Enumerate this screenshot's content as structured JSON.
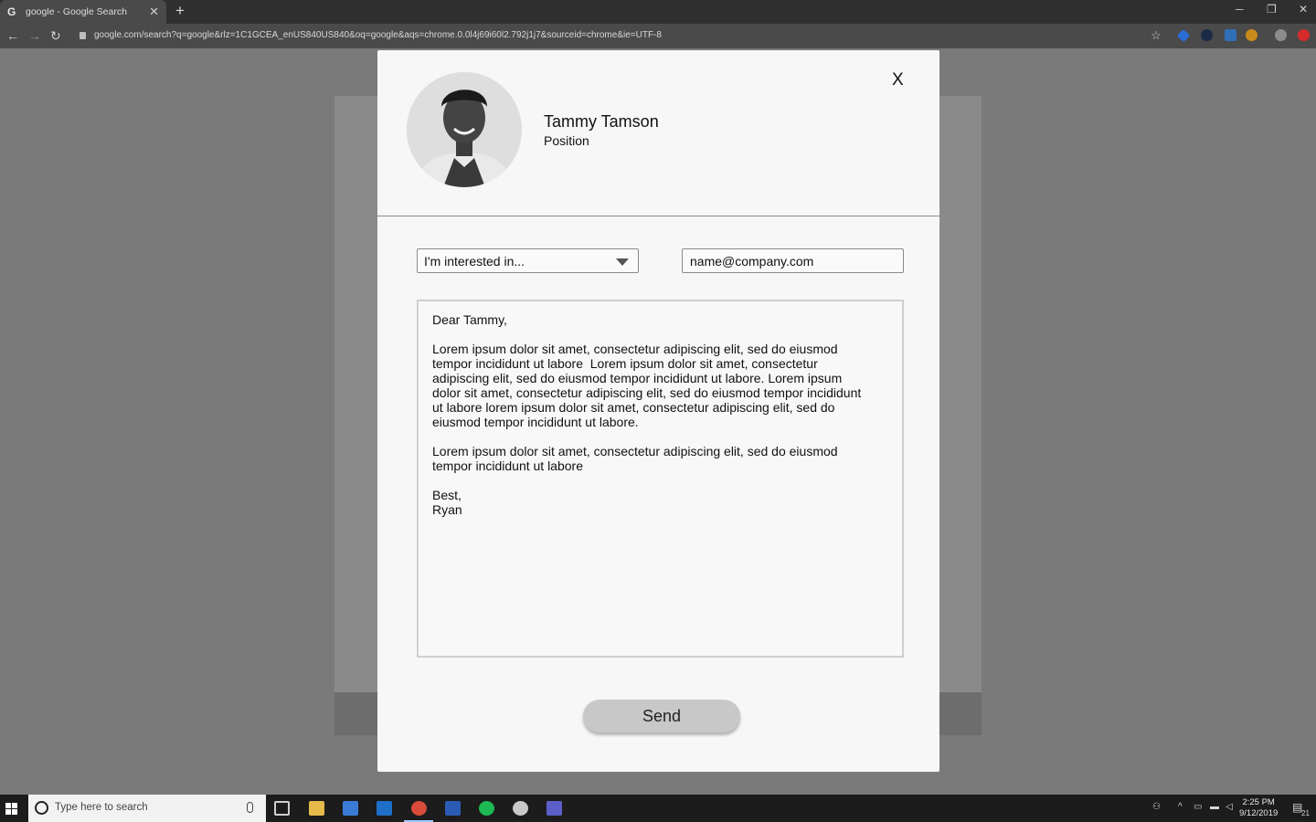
{
  "browser": {
    "tab_title": "google - Google Search",
    "tab_favicon": "G",
    "url": "google.com/search?q=google&rlz=1C1GCEA_enUS840US840&oq=google&aqs=chrome.0.0l4j69i60l2.792j1j7&sourceid=chrome&ie=UTF-8"
  },
  "modal": {
    "close_label": "X",
    "contact": {
      "name": "Tammy Tamson",
      "position": "Position"
    },
    "interest_select": {
      "selected": "I'm interested in..."
    },
    "email_field": {
      "value": "name@company.com"
    },
    "message": {
      "greeting": "Dear Tammy,",
      "paragraph1": "Lorem ipsum dolor sit amet, consectetur adipiscing elit, sed do eiusmod\ntempor incididunt ut labore  Lorem ipsum dolor sit amet, consectetur\nadipiscing elit, sed do eiusmod tempor incididunt ut labore. Lorem ipsum\ndolor sit amet, consectetur adipiscing elit, sed do eiusmod tempor incididunt\nut labore lorem ipsum dolor sit amet, consectetur adipiscing elit, sed do\neiusmod tempor incididunt ut labore.",
      "paragraph2": "Lorem ipsum dolor sit amet, consectetur adipiscing elit, sed do eiusmod\ntempor incididunt ut labore",
      "signoff": "Best,\nRyan"
    },
    "send_label": "Send"
  },
  "taskbar": {
    "search_placeholder": "Type here to search",
    "clock_time": "2:25 PM",
    "clock_date": "9/12/2019",
    "notification_count": "21",
    "apps": [
      "task-view",
      "file-explorer",
      "store",
      "outlook",
      "chrome",
      "word",
      "spotify",
      "slack",
      "teams"
    ]
  },
  "colors": {
    "overlay": "#7a7a7a",
    "modal_bg": "#f7f7f7",
    "send_button": "#c8c8c8",
    "taskbar": "#1c1c1c"
  }
}
